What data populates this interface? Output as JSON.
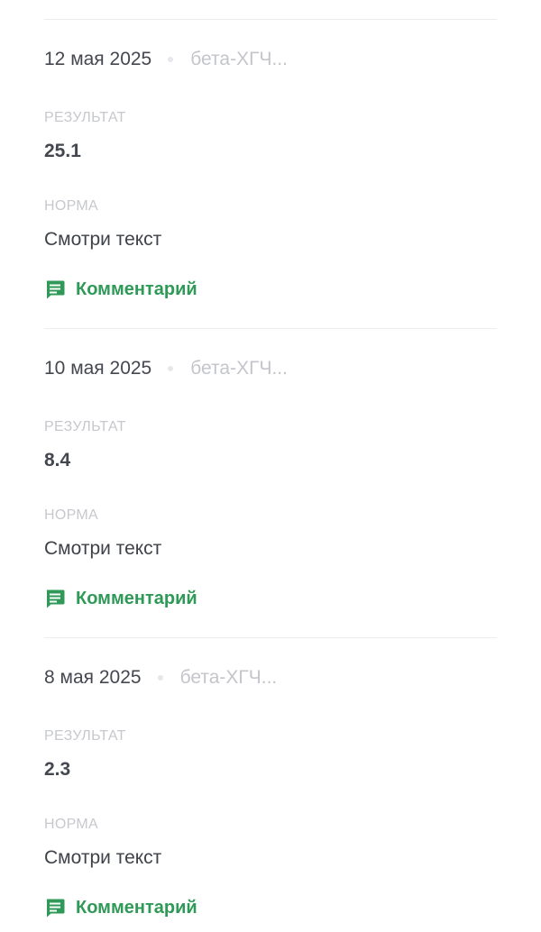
{
  "colors": {
    "accent": "#2f9a57",
    "text_primary": "#44474f",
    "text_muted": "#c6c8cd",
    "divider": "#ececef"
  },
  "entries": [
    {
      "date": "12 мая 2025",
      "lab": "бета-ХГЧ...",
      "result_label": "РЕЗУЛЬТАТ",
      "result_value": "25.1",
      "norm_label": "НОРМА",
      "norm_value": "Смотри текст",
      "comment_label": "Комментарий",
      "comment_icon": "comment-icon"
    },
    {
      "date": "10 мая 2025",
      "lab": "бета-ХГЧ...",
      "result_label": "РЕЗУЛЬТАТ",
      "result_value": "8.4",
      "norm_label": "НОРМА",
      "norm_value": "Смотри текст",
      "comment_label": "Комментарий",
      "comment_icon": "comment-icon"
    },
    {
      "date": "8 мая 2025",
      "lab": "бета-ХГЧ...",
      "result_label": "РЕЗУЛЬТАТ",
      "result_value": "2.3",
      "norm_label": "НОРМА",
      "norm_value": "Смотри текст",
      "comment_label": "Комментарий",
      "comment_icon": "comment-icon"
    }
  ]
}
